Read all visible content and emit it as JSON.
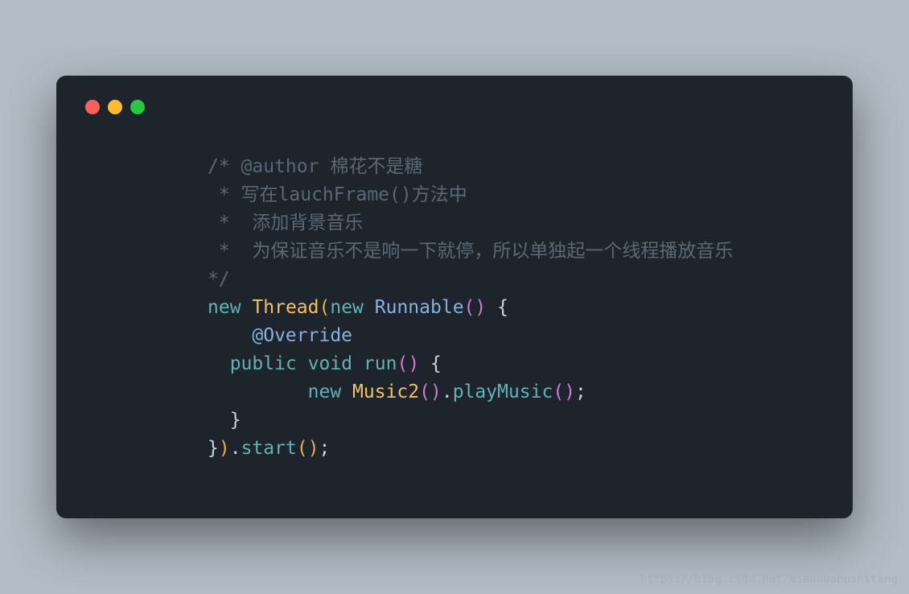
{
  "code": {
    "c1": "/* @author 棉花不是糖",
    "c2": " * 写在lauchFrame()方法中",
    "c3": " *  添加背景音乐",
    "c4": " *  为保证音乐不是响一下就停，所以单独起一个线程播放音乐",
    "c5": "*/",
    "kw_new1": "new",
    "type_thread": "Thread",
    "paren_open1": "(",
    "kw_new2": "new",
    "type_runnable": "Runnable",
    "paren_open2": "(",
    "paren_close2": ")",
    "brace_open1": " {",
    "annotation": "@Override",
    "kw_public": "public",
    "kw_void": "void",
    "m_run": "run",
    "paren_open3": "(",
    "paren_close3": ")",
    "brace_open2": " {",
    "kw_new3": "new",
    "type_music": "Music2",
    "paren_open4": "(",
    "paren_close4": ")",
    "dot1": ".",
    "m_play": "playMusic",
    "paren_open5": "(",
    "paren_close5": ")",
    "semi1": ";",
    "brace_close2": "}",
    "brace_close1": "}",
    "paren_close1": ")",
    "dot2": ".",
    "m_start": "start",
    "paren_open6": "(",
    "paren_close6": ")",
    "semi2": ";"
  },
  "watermark": "https://blog.csdn.net/mianhuabushitang"
}
